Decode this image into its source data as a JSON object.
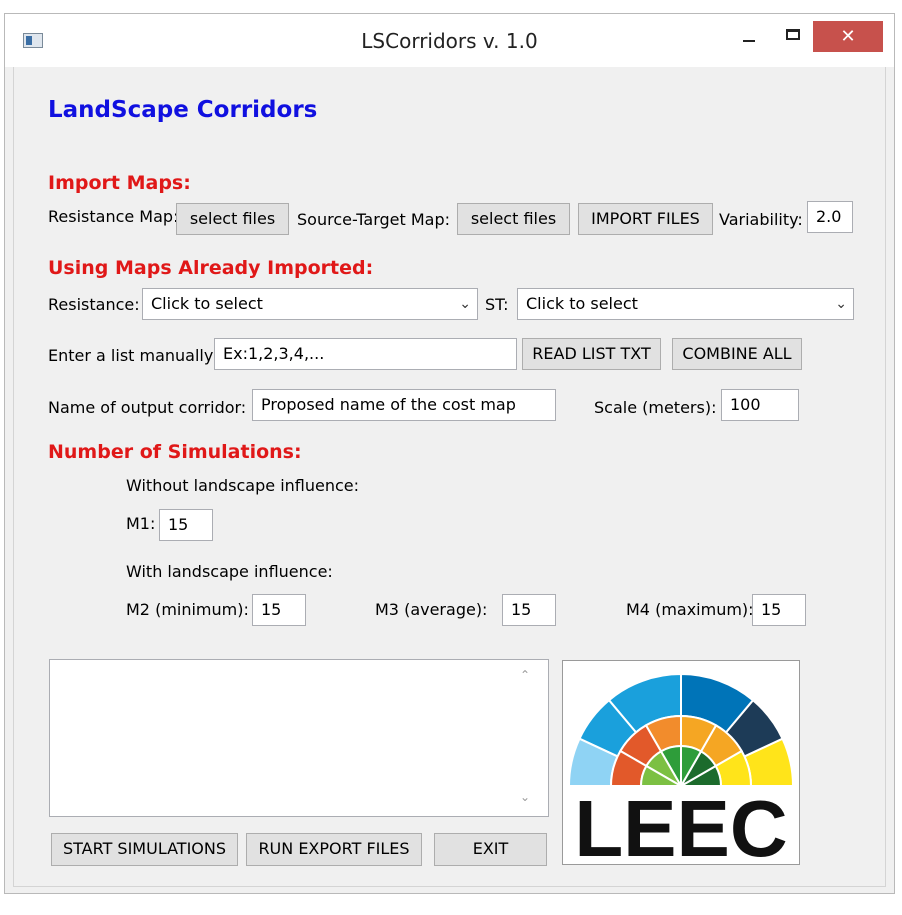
{
  "window": {
    "title": "LSCorridors v. 1.0",
    "close_glyph": "✕"
  },
  "header": {
    "title": "LandScape Corridors"
  },
  "import_maps": {
    "heading": "Import Maps:",
    "resistance_label": "Resistance Map:",
    "resistance_button": "select files",
    "source_target_label": "Source-Target Map:",
    "source_target_button": "select files",
    "import_button": "IMPORT FILES",
    "variability_label": "Variability:",
    "variability_value": "2.0"
  },
  "using_maps": {
    "heading": "Using Maps Already Imported:",
    "resistance_label": "Resistance:",
    "resistance_select": "Click to select",
    "st_label": "ST:",
    "st_select": "Click to select",
    "list_label": "Enter a list manually:",
    "list_value": "Ex:1,2,3,4,...",
    "read_list_button": "READ LIST TXT",
    "combine_button": "COMBINE ALL",
    "output_label": "Name of output corridor:",
    "output_value": "Proposed name of the cost map",
    "scale_label": "Scale (meters):",
    "scale_value": "100"
  },
  "simulations": {
    "heading": "Number of Simulations:",
    "without_label": "Without landscape influence:",
    "m1_label": "M1:",
    "m1_value": "15",
    "with_label": "With landscape influence:",
    "m2_label": "M2 (minimum):",
    "m2_value": "15",
    "m3_label": "M3 (average):",
    "m3_value": "15",
    "m4_label": "M4 (maximum):",
    "m4_value": "15"
  },
  "footer": {
    "start_button": "START SIMULATIONS",
    "export_button": "RUN EXPORT FILES",
    "exit_button": "EXIT"
  },
  "logo": {
    "text": "LEEC",
    "colors": [
      "#8fd3f4",
      "#1aa0dc",
      "#0074b8",
      "#e2592a",
      "#f28c2c",
      "#f5a623",
      "#7cc043",
      "#2e9d3a",
      "#1c6b2c",
      "#ffe41a",
      "#1d3b57"
    ]
  }
}
